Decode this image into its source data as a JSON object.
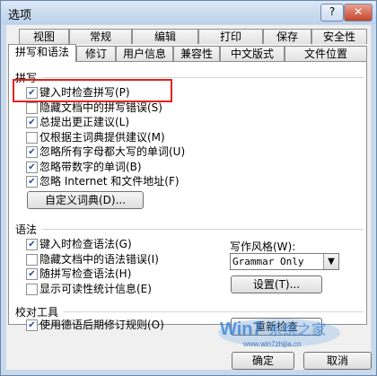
{
  "window": {
    "title": "选项"
  },
  "titlebar": {
    "help": "?",
    "close": "✕"
  },
  "tabs": {
    "back": [
      "视图",
      "常规",
      "编辑",
      "打印",
      "保存",
      "安全性"
    ],
    "front": [
      "拼写和语法",
      "修订",
      "用户信息",
      "兼容性",
      "中文版式",
      "文件位置"
    ]
  },
  "spelling": {
    "heading": "拼写",
    "options": [
      {
        "label": "键入时检查拼写(P)",
        "checked": true
      },
      {
        "label": "隐藏文档中的拼写错误(S)",
        "checked": false
      },
      {
        "label": "总提出更正建议(L)",
        "checked": true
      },
      {
        "label": "仅根据主词典提供建议(M)",
        "checked": false
      },
      {
        "label": "忽略所有字母都大写的单词(U)",
        "checked": true
      },
      {
        "label": "忽略带数字的单词(B)",
        "checked": true
      },
      {
        "label": "忽略 Internet 和文件地址(F)",
        "checked": true
      }
    ],
    "custom_dict_button": "自定义词典(D)..."
  },
  "grammar": {
    "heading": "语法",
    "options": [
      {
        "label": "键入时检查语法(G)",
        "checked": true
      },
      {
        "label": "隐藏文档中的语法错误(I)",
        "checked": false
      },
      {
        "label": "随拼写检查语法(H)",
        "checked": true
      },
      {
        "label": "显示可读性统计信息(E)",
        "checked": false
      }
    ],
    "style_label": "写作风格(W):",
    "style_value": "Grammar Only",
    "settings_button": "设置(T)..."
  },
  "proofing": {
    "heading": "校对工具",
    "options": [
      {
        "label": "使用德语后期修订规则(O)",
        "checked": true
      }
    ],
    "recheck_button": "重新检查"
  },
  "footer": {
    "ok": "确定",
    "cancel": "取消"
  },
  "watermark": {
    "text": "Win7系统之家",
    "url": "www.win7zhijia.cn"
  },
  "colors": {
    "highlight": "#e2231a"
  }
}
